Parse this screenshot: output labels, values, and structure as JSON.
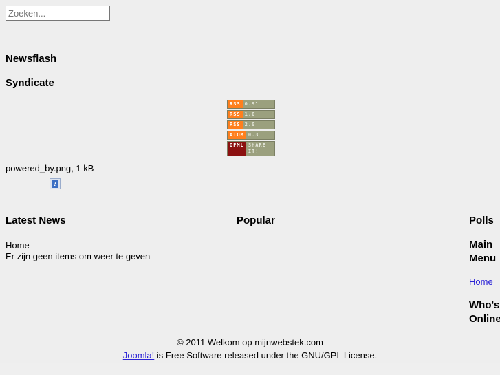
{
  "search": {
    "placeholder": "Zoeken...",
    "value": ""
  },
  "modules": {
    "newsflash": {
      "title": "Newsflash"
    },
    "syndicate": {
      "title": "Syndicate",
      "feeds": [
        {
          "tag": "RSS",
          "value": "0.91",
          "tag_color": "#ff7f1e"
        },
        {
          "tag": "RSS",
          "value": "1.0",
          "tag_color": "#ff7f1e"
        },
        {
          "tag": "RSS",
          "value": "2.0",
          "tag_color": "#ff7f1e"
        },
        {
          "tag": "ATOM",
          "value": "0.3",
          "tag_color": "#ff7f1e"
        },
        {
          "tag": "OPML",
          "value": "SHARE IT!",
          "tag_color": "#8b1010"
        }
      ]
    },
    "powered_by": {
      "caption": "powered_by.png, 1 kB",
      "broken_image_glyph": "?"
    },
    "latest_news": {
      "title": "Latest News",
      "items": [
        "Home",
        "Er zijn geen items om weer te geven"
      ]
    },
    "popular": {
      "title": "Popular"
    },
    "polls": {
      "title": "Polls"
    },
    "main_menu": {
      "title": "Main Menu",
      "items": [
        {
          "label": "Home"
        }
      ]
    },
    "whos_online": {
      "title": "Who's Online"
    }
  },
  "footer": {
    "copyright": "© 2011 Welkom op mijnwebstek.com",
    "license_link": "Joomla!",
    "license_text": " is Free Software released under the GNU/GPL License."
  },
  "colors": {
    "page_background": "#eeeeee",
    "link": "#2b23d6",
    "badge_orange": "#ff7f1e",
    "badge_dark_red": "#8b1010",
    "badge_value_bg": "#9ba07e"
  }
}
